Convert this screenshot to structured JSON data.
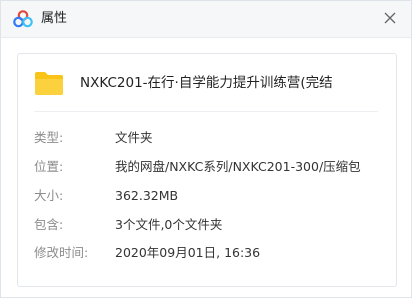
{
  "window": {
    "title": "属性",
    "icons": {
      "app": "baidu-netdisk-cloud-icon",
      "close": "close-icon"
    }
  },
  "file": {
    "name": "NXKC201-在行·自学能力提升训练营(完结",
    "icon": "folder-icon",
    "icon_color": "#f9c417"
  },
  "properties": [
    {
      "label": "类型:",
      "value": "文件夹"
    },
    {
      "label": "位置:",
      "value": "我的网盘/NXKC系列/NXKC201-300/压缩包"
    },
    {
      "label": "大小:",
      "value": "362.32MB"
    },
    {
      "label": "包含:",
      "value": "3个文件,0个文件夹"
    },
    {
      "label": "修改时间:",
      "value": "2020年09月01日, 16:36"
    }
  ]
}
